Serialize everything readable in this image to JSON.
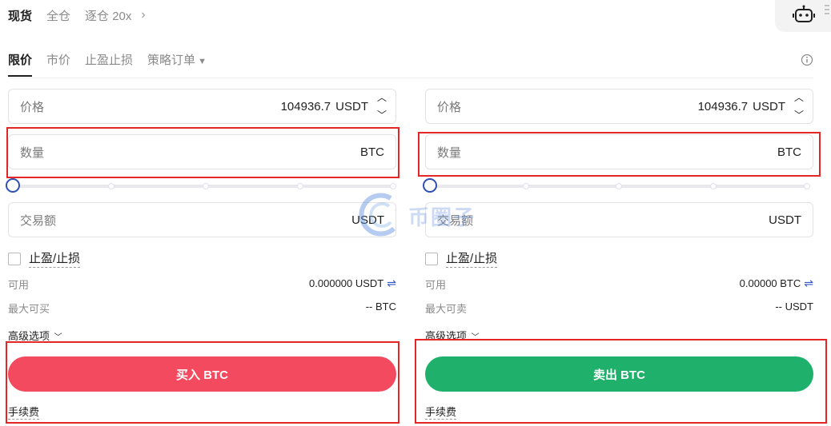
{
  "top_tabs": {
    "spot": "现货",
    "cross": "全仓",
    "isolated": "逐仓 20x",
    "more": "›"
  },
  "order_tabs": {
    "limit": "限价",
    "market": "市价",
    "tpsl": "止盈止损",
    "strategy": "策略订单",
    "strategy_caret": "▼"
  },
  "buy": {
    "price_label": "价格",
    "price_value": "104936.7",
    "price_unit": "USDT",
    "qty_label": "数量",
    "qty_unit": "BTC",
    "total_label": "交易额",
    "total_unit": "USDT",
    "tpsl_label": "止盈/止损",
    "avail_label": "可用",
    "avail_value": "0.000000 USDT",
    "max_label": "最大可买",
    "max_value": "-- BTC",
    "advanced": "高级选项",
    "button": "买入 BTC",
    "fee": "手续费"
  },
  "sell": {
    "price_label": "价格",
    "price_value": "104936.7",
    "price_unit": "USDT",
    "qty_label": "数量",
    "qty_unit": "BTC",
    "total_label": "交易额",
    "total_unit": "USDT",
    "tpsl_label": "止盈/止损",
    "avail_label": "可用",
    "avail_value": "0.00000 BTC",
    "max_label": "最大可卖",
    "max_value": "-- USDT",
    "advanced": "高级选项",
    "button": "卖出 BTC",
    "fee": "手续费"
  },
  "watermark": "币圈子",
  "colors": {
    "buy": "#f34a5f",
    "sell": "#1fb16b",
    "accent": "#2f4fb5",
    "highlight": "#e32626"
  },
  "icons": {
    "robot": "robot-icon",
    "info": "info-icon",
    "swap": "swap-icon",
    "up": "chevron-up-icon",
    "down": "chevron-down-icon"
  }
}
